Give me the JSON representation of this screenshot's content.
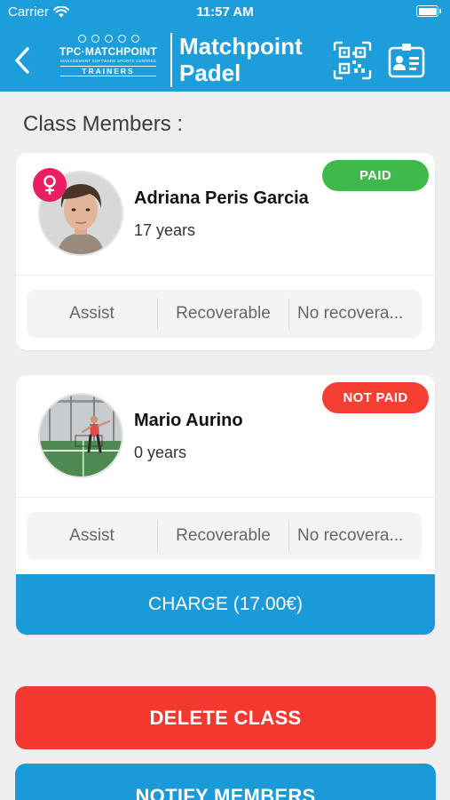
{
  "status_bar": {
    "carrier": "Carrier",
    "time": "11:57 AM"
  },
  "header": {
    "logo": {
      "brand": "TPC·MATCHPOINT",
      "tagline": "MANAGEMENT SOFTWARE SPORTS CENTRES",
      "sub": "TRAINERS"
    },
    "title_line1": "Matchpoint",
    "title_line2": "Padel",
    "icons": [
      "chevron-left-icon",
      "qr-code-icon",
      "id-card-icon"
    ]
  },
  "section_title": "Class Members :",
  "members": [
    {
      "name": "Adriana Peris Garcia",
      "age": "17 years",
      "payment_status": "PAID",
      "payment_color": "#3fba4a",
      "gender_icon": "female-icon",
      "gender_color": "#e91e63",
      "options": [
        "Assist",
        "Recoverable",
        "No recovera..."
      ]
    },
    {
      "name": "Mario Aurino",
      "age": "0 years",
      "payment_status": "NOT PAID",
      "payment_color": "#f43f32",
      "options": [
        "Assist",
        "Recoverable",
        "No recovera..."
      ],
      "charge_label": "CHARGE (17.00€)"
    }
  ],
  "actions": {
    "delete_label": "DELETE CLASS",
    "notify_label": "NOTIFY MEMBERS"
  },
  "colors": {
    "header_blue": "#1e9ddb",
    "button_blue": "#1a9ad8",
    "danger_red": "#f3392f",
    "paid_green": "#3fba4a"
  }
}
